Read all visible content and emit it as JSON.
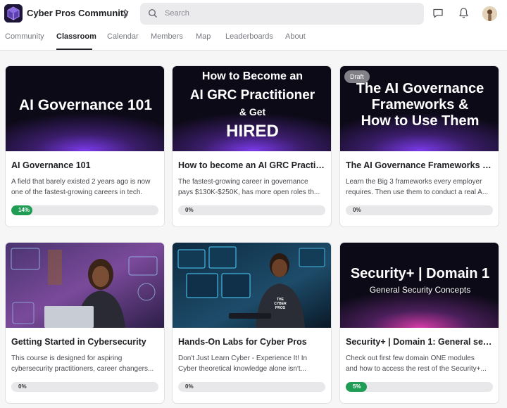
{
  "header": {
    "community_name": "Cyber Pros Community",
    "search_placeholder": "Search"
  },
  "tabs": [
    {
      "label": "Community",
      "active": false
    },
    {
      "label": "Classroom",
      "active": true
    },
    {
      "label": "Calendar",
      "active": false
    },
    {
      "label": "Members",
      "active": false
    },
    {
      "label": "Map",
      "active": false
    },
    {
      "label": "Leaderboards",
      "active": false
    },
    {
      "label": "About",
      "active": false
    }
  ],
  "courses": [
    {
      "thumb_lines": [
        "AI Governance 101"
      ],
      "title": "AI Governance 101",
      "desc_lines": [
        "A field that barely existed 2 years ago is now",
        "one of the fastest-growing careers in tech."
      ],
      "progress": 14,
      "progress_label": "14%"
    },
    {
      "thumb_lines": [
        "How to Become an",
        "AI GRC Practitioner",
        "& Get",
        "HIRED"
      ],
      "title": "How to become an AI GRC Practiti...",
      "desc_lines": [
        "The fastest-growing career in governance",
        "pays $130K-$250K, has more open roles th..."
      ],
      "progress": 0,
      "progress_label": "0%"
    },
    {
      "draft_label": "Draft",
      "thumb_lines": [
        "The AI Governance",
        "Frameworks &",
        "How to Use Them"
      ],
      "title": "The AI Governance Frameworks &...",
      "desc_lines": [
        "Learn the Big 3 frameworks every employer",
        "requires. Then use them to conduct a real A..."
      ],
      "progress": 0,
      "progress_label": "0%"
    },
    {
      "thumb_photo": "woman-at-laptop",
      "title": "Getting Started in Cybersecurity",
      "desc_lines": [
        "This course is designed for aspiring",
        "cybersecurity practitioners, career changers..."
      ],
      "progress": 0,
      "progress_label": "0%"
    },
    {
      "thumb_photo": "man-at-monitors",
      "thumb_shirt_lines": [
        "THE",
        "CYBER",
        "PROS"
      ],
      "title": "Hands-On Labs for Cyber Pros",
      "desc_lines": [
        "Don't Just Learn Cyber - Experience It! In",
        "Cyber theoretical knowledge alone isn't..."
      ],
      "progress": 0,
      "progress_label": "0%"
    },
    {
      "thumb_lines": [
        "Security+ | Domain 1",
        "General Security Concepts"
      ],
      "title": "Security+ | Domain 1: General sec...",
      "desc_lines": [
        "Check out first few domain ONE modules",
        "and how to access the rest of the Security+..."
      ],
      "progress": 5,
      "progress_label": "5%"
    }
  ],
  "colors": {
    "progress_fill": "#1f9d55",
    "accent_purple": "#7c3aed",
    "accent_pink": "#d63aa8"
  }
}
